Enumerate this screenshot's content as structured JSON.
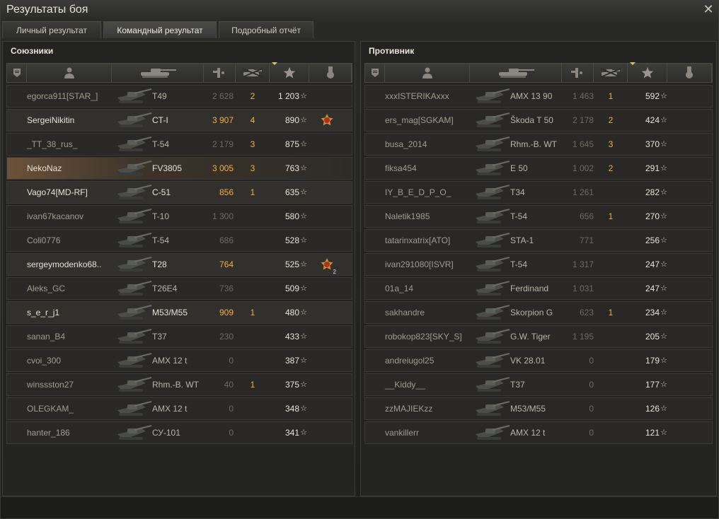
{
  "window": {
    "title": "Результаты боя",
    "close_icon": "close-icon"
  },
  "tabs": [
    {
      "label": "Личный результат",
      "active": false
    },
    {
      "label": "Командный результат",
      "active": true
    },
    {
      "label": "Подробный отчёт",
      "active": false
    }
  ],
  "allies": {
    "title": "Союзники",
    "columns": [
      "rank-icon",
      "player-icon",
      "tank-icon",
      "damage-icon",
      "frags-icon",
      "experience-star-icon",
      "medal-icon"
    ],
    "rows": [
      {
        "player": "egorca911[STAR_]",
        "tank": "T49",
        "damage": "2 628",
        "frags": "2",
        "xp": "1 203",
        "medal": ""
      },
      {
        "player": "SergeiNikitin",
        "tank": "CT-I",
        "damage": "3 907",
        "frags": "4",
        "xp": "890",
        "medal": "award-medal-icon"
      },
      {
        "player": "_TT_38_rus_",
        "tank": "T-54",
        "damage": "2 179",
        "frags": "3",
        "xp": "875",
        "medal": ""
      },
      {
        "player": "NekoNaz",
        "tank": "FV3805",
        "damage": "3 005",
        "frags": "3",
        "xp": "763",
        "medal": ""
      },
      {
        "player": "Vago74[MD-RF]",
        "tank": "C-51",
        "damage": "856",
        "frags": "1",
        "xp": "635",
        "medal": ""
      },
      {
        "player": "ivan67kacanov",
        "tank": "T-10",
        "damage": "1 300",
        "frags": "",
        "xp": "580",
        "medal": ""
      },
      {
        "player": "Coli0776",
        "tank": "T-54",
        "damage": "686",
        "frags": "",
        "xp": "528",
        "medal": ""
      },
      {
        "player": "sergeymodenko68..",
        "tank": "T28",
        "damage": "764",
        "frags": "",
        "xp": "525",
        "medal": "award-medal-icon",
        "medal_count": "2"
      },
      {
        "player": "Aleks_GC",
        "tank": "T26E4",
        "damage": "736",
        "frags": "",
        "xp": "509",
        "medal": ""
      },
      {
        "player": "s_e_r_j1",
        "tank": "M53/M55",
        "damage": "909",
        "frags": "1",
        "xp": "480",
        "medal": ""
      },
      {
        "player": "sanan_B4",
        "tank": "T37",
        "damage": "230",
        "frags": "",
        "xp": "433",
        "medal": ""
      },
      {
        "player": "cvoi_300",
        "tank": "AMX 12 t",
        "damage": "0",
        "frags": "",
        "xp": "387",
        "medal": ""
      },
      {
        "player": "winssston27",
        "tank": "Rhm.-B. WT",
        "damage": "40",
        "frags": "1",
        "xp": "375",
        "medal": ""
      },
      {
        "player": "OLEGKAM_",
        "tank": "AMX 12 t",
        "damage": "0",
        "frags": "",
        "xp": "348",
        "medal": ""
      },
      {
        "player": "hanter_186",
        "tank": "СУ-101",
        "damage": "0",
        "frags": "",
        "xp": "341",
        "medal": ""
      }
    ]
  },
  "enemies": {
    "title": "Противник",
    "rows": [
      {
        "player": "xxxISTERIKAxxx",
        "tank": "AMX 13 90",
        "damage": "1 463",
        "frags": "1",
        "xp": "592"
      },
      {
        "player": "ers_mag[SGKAM]",
        "tank": "Škoda T 50",
        "damage": "2 178",
        "frags": "2",
        "xp": "424"
      },
      {
        "player": "busa_2014",
        "tank": "Rhm.-B. WT",
        "damage": "1 645",
        "frags": "3",
        "xp": "370"
      },
      {
        "player": "fiksa454",
        "tank": "E 50",
        "damage": "1 002",
        "frags": "2",
        "xp": "291"
      },
      {
        "player": "IY_B_E_D_P_O_",
        "tank": "T34",
        "damage": "1 261",
        "frags": "",
        "xp": "282"
      },
      {
        "player": "Naletik1985",
        "tank": "T-54",
        "damage": "656",
        "frags": "1",
        "xp": "270"
      },
      {
        "player": "tatarinxatrix[ATO]",
        "tank": "STA-1",
        "damage": "771",
        "frags": "",
        "xp": "256"
      },
      {
        "player": "ivan291080[ISVR]",
        "tank": "T-54",
        "damage": "1 317",
        "frags": "",
        "xp": "247"
      },
      {
        "player": "01a_14",
        "tank": "Ferdinand",
        "damage": "1 031",
        "frags": "",
        "xp": "247"
      },
      {
        "player": "sakhandre",
        "tank": "Skorpion G",
        "damage": "623",
        "frags": "1",
        "xp": "234"
      },
      {
        "player": "robokop823[SKY_S]",
        "tank": "G.W. Tiger",
        "damage": "1 195",
        "frags": "",
        "xp": "205"
      },
      {
        "player": "andreiugol25",
        "tank": "VK 28.01",
        "damage": "0",
        "frags": "",
        "xp": "179"
      },
      {
        "player": "__Kiddy__",
        "tank": "T37",
        "damage": "0",
        "frags": "",
        "xp": "177"
      },
      {
        "player": "zzMAJIEKzz",
        "tank": "M53/M55",
        "damage": "0",
        "frags": "",
        "xp": "126"
      },
      {
        "player": "vankillerr",
        "tank": "AMX 12 t",
        "damage": "0",
        "frags": "",
        "xp": "121"
      }
    ]
  },
  "colors": {
    "accent": "#f0b040",
    "text_bright": "#e6e2d6",
    "text_dim": "#a09c90",
    "self_row": "#6a5238"
  }
}
